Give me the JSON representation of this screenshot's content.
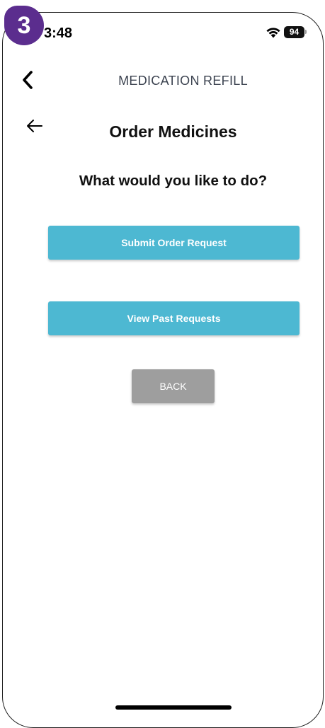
{
  "status_bar": {
    "time": "3:48",
    "battery": "94"
  },
  "step_badge": "3",
  "nav": {
    "title": "MEDICATION REFILL"
  },
  "page": {
    "title": "Order Medicines",
    "question": "What would you like to do?"
  },
  "actions": {
    "submit_label": "Submit Order Request",
    "view_label": "View Past Requests",
    "back_label": "BACK"
  },
  "colors": {
    "primary_button": "#4db8d2",
    "back_button": "#9e9e9e",
    "badge": "#5b2d8e"
  },
  "icons": {
    "nav_back": "chevron-left-icon",
    "page_back": "arrow-left-icon",
    "wifi": "wifi-icon"
  }
}
